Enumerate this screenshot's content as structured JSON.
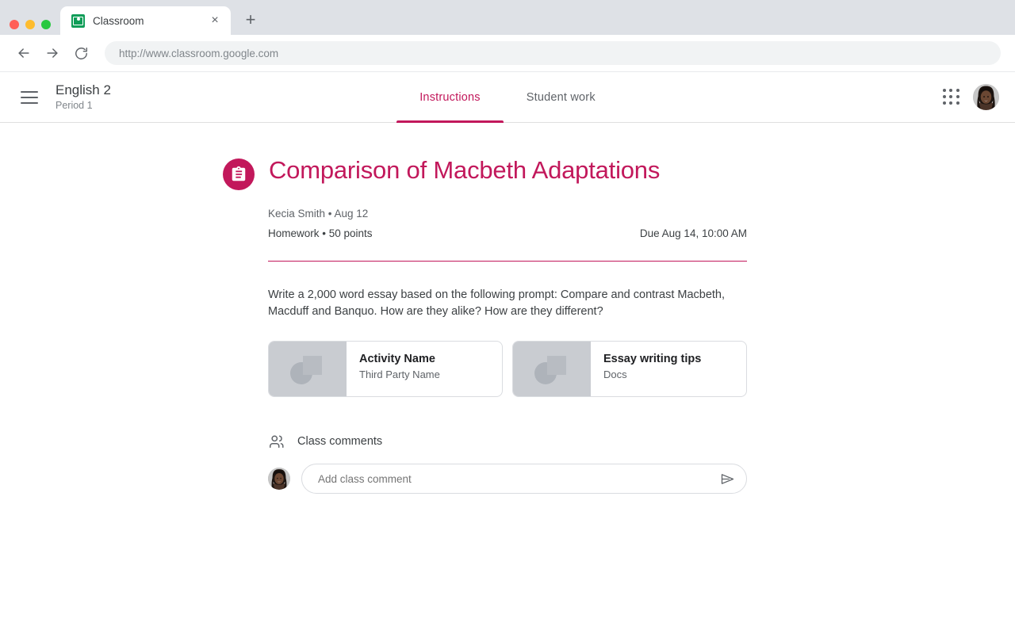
{
  "browser": {
    "tab": {
      "title": "Classroom",
      "favicon": "classroom-icon",
      "close_label": "×"
    },
    "new_tab_label": "+",
    "nav": {
      "back": "back-arrow-icon",
      "forward": "forward-arrow-icon",
      "reload": "reload-icon"
    },
    "url": "http://www.classroom.google.com"
  },
  "app_header": {
    "menu_icon": "hamburger-menu-icon",
    "class_name": "English 2",
    "class_section": "Period 1",
    "tabs": [
      {
        "label": "Instructions",
        "active": true
      },
      {
        "label": "Student work",
        "active": false
      }
    ],
    "apps_icon": "apps-grid-icon",
    "avatar": "user-avatar"
  },
  "assignment": {
    "icon": "assignment-clipboard-icon",
    "title": "Comparison of Macbeth Adaptations",
    "author_line": "Kecia Smith  • Aug 12",
    "category_points": "Homework • 50 points",
    "due": "Due Aug 14, 10:00 AM",
    "description": "Write a 2,000 word essay based on the following prompt: Compare and contrast Macbeth, Macduff and Banquo. How are they alike? How are they different?",
    "attachments": [
      {
        "title": "Activity Name",
        "subtitle": "Third Party Name",
        "thumbnail": "image-placeholder"
      },
      {
        "title": "Essay writing tips",
        "subtitle": "Docs",
        "thumbnail": "image-placeholder"
      }
    ]
  },
  "comments": {
    "icon": "people-icon",
    "heading": "Class comments",
    "avatar": "user-avatar",
    "input_value": "",
    "input_placeholder": "Add class comment",
    "send_icon": "send-icon"
  },
  "colors": {
    "accent_pink": "#c2185b",
    "text_primary": "#3c4043",
    "text_secondary": "#5f6368",
    "chrome_bg": "#dee1e6",
    "favicon_green": "#0f9d58"
  }
}
